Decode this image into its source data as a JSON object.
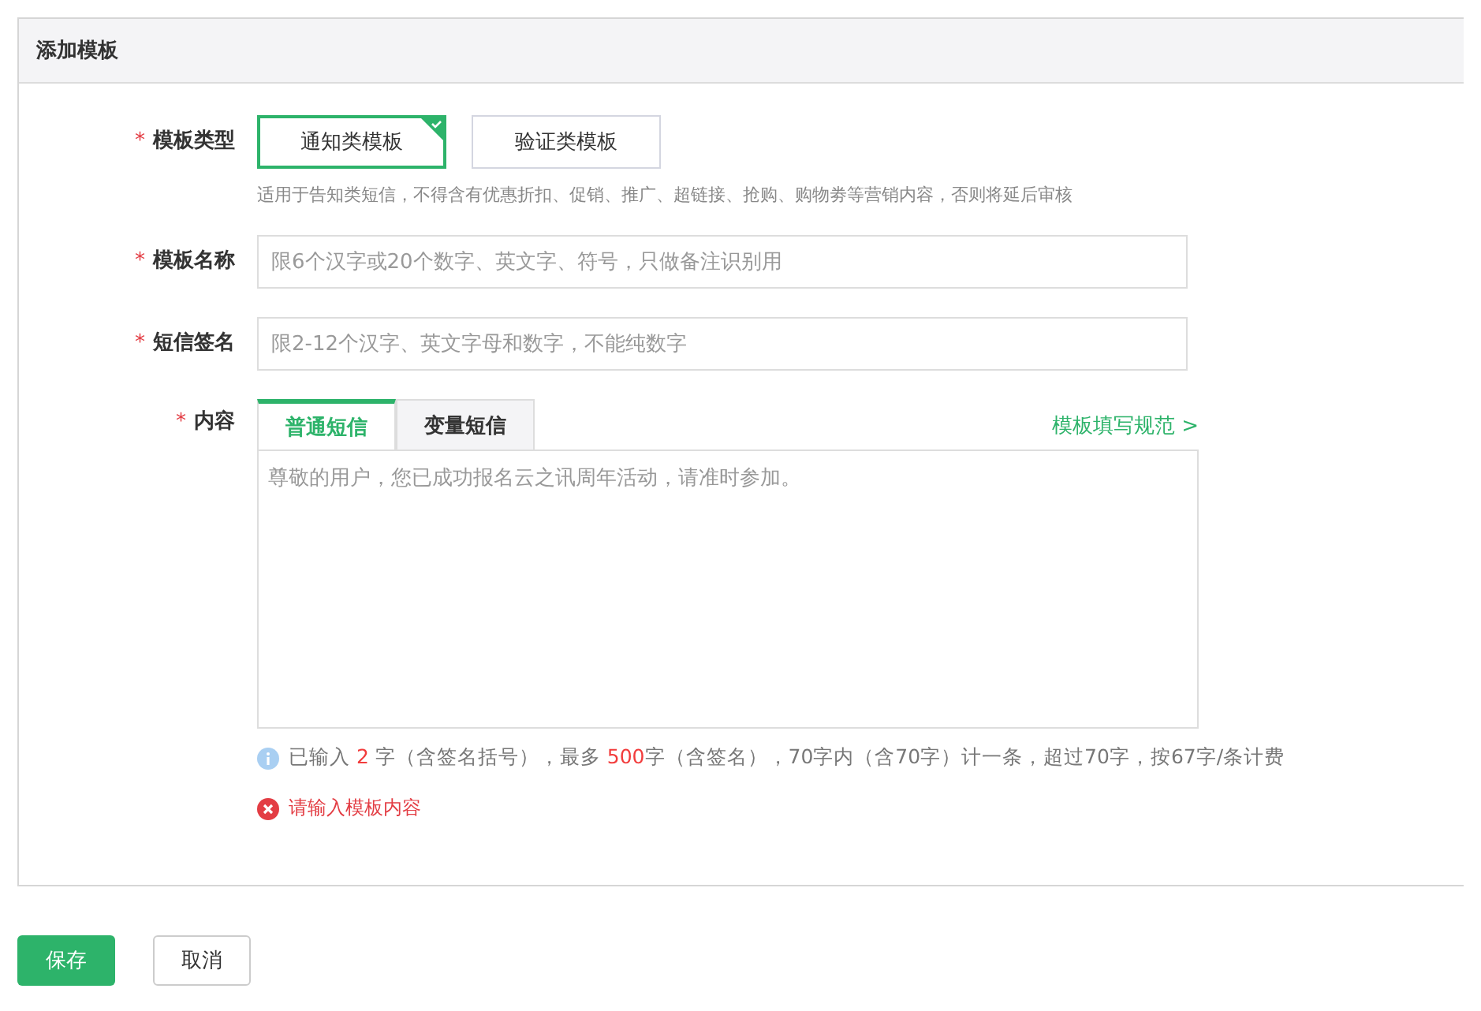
{
  "panel": {
    "title": "添加模板"
  },
  "type_field": {
    "label": "模板类型",
    "required_mark": "*",
    "options": [
      {
        "label": "通知类模板",
        "selected": true
      },
      {
        "label": "验证类模板",
        "selected": false
      }
    ],
    "hint": "适用于告知类短信，不得含有优惠折扣、促销、推广、超链接、抢购、购物劵等营销内容，否则将延后审核"
  },
  "name_field": {
    "label": "模板名称",
    "required_mark": "*",
    "placeholder": "限6个汉字或20个数字、英文字、符号，只做备注识别用"
  },
  "sign_field": {
    "label": "短信签名",
    "required_mark": "*",
    "placeholder": "限2-12个汉字、英文字母和数字，不能纯数字"
  },
  "content_field": {
    "label": "内容",
    "required_mark": "*",
    "tabs": [
      {
        "label": "普通短信",
        "selected": true
      },
      {
        "label": "变量短信",
        "selected": false
      }
    ],
    "guide_link": "模板填写规范 >",
    "placeholder": "尊敬的用户，您已成功报名云之讯周年活动，请准时参加。",
    "counter": [
      {
        "text": "已输入 ",
        "highlight": false
      },
      {
        "text": "2",
        "highlight": true
      },
      {
        "text": " 字（含签名括号），最多 ",
        "highlight": false
      },
      {
        "text": "500",
        "highlight": true
      },
      {
        "text": "字（含签名），70字内（含70字）计一条，超过70字，按67字/条计费",
        "highlight": false
      }
    ],
    "error": "请输入模板内容"
  },
  "buttons": [
    {
      "label": "保存",
      "kind": "primary"
    },
    {
      "label": "取消",
      "kind": "default"
    }
  ]
}
